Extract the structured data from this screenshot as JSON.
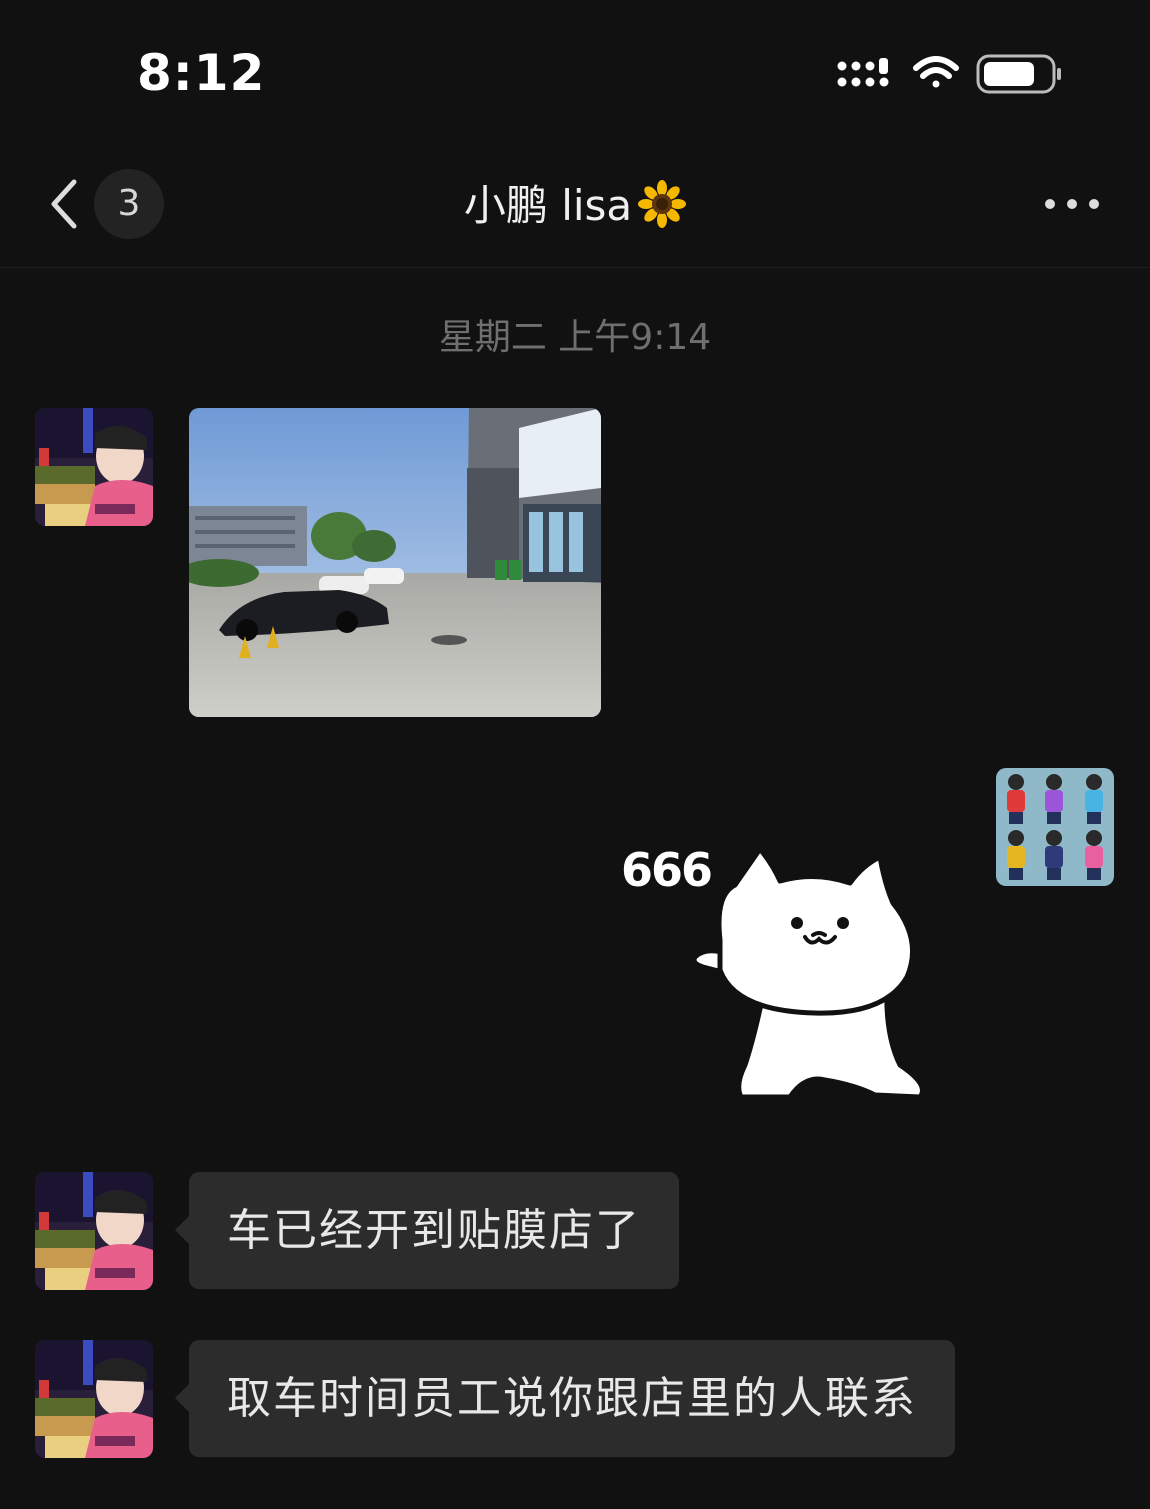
{
  "status_bar": {
    "time": "8:12"
  },
  "header": {
    "unread_count": "3",
    "title": "小鹏 lisa",
    "title_emoji": "sunflower",
    "more_icon": "more-dots-icon",
    "back_icon": "chevron-left-icon"
  },
  "chat": {
    "timestamp": "星期二 上午9:14",
    "messages": [
      {
        "sender": "contact",
        "type": "image",
        "description": "photo"
      },
      {
        "sender": "self",
        "type": "sticker",
        "text": "666"
      },
      {
        "sender": "contact",
        "type": "text",
        "text": "车已经开到贴膜店了"
      },
      {
        "sender": "contact",
        "type": "text",
        "text": "取车时间员工说你跟店里的人联系"
      }
    ]
  },
  "colors": {
    "background": "#111111",
    "bubble": "#2c2c2c",
    "timestamp": "#6f6f6f"
  }
}
